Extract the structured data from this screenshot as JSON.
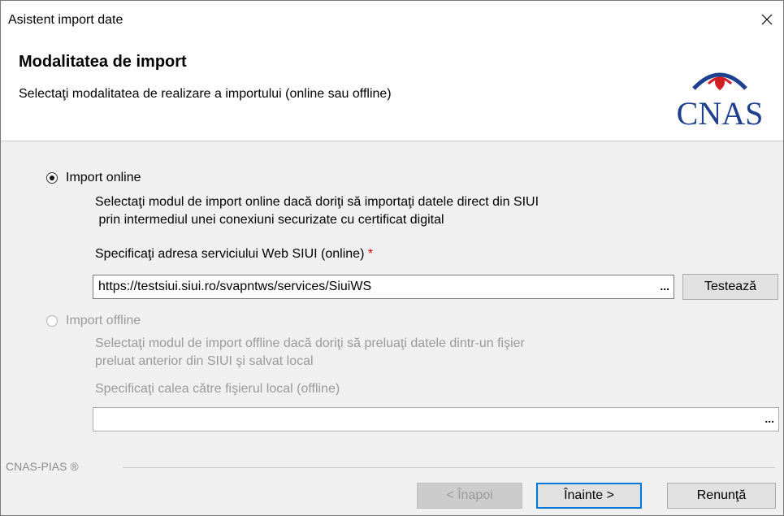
{
  "window": {
    "title": "Asistent import date"
  },
  "header": {
    "heading": "Modalitatea de import",
    "subheading": "Selectaţi modalitatea de realizare a importului (online sau offline)",
    "logo_text": "CNAS"
  },
  "online": {
    "radio_label": "Import online",
    "checked": true,
    "desc_line1": "Selectaţi modul de import online dacă doriţi să importaţi datele direct din SIUI",
    "desc_line2": " prin intermediul unei conexiuni securizate cu certificat digital",
    "address_label": "Specificaţi adresa serviciului Web SIUI (online)",
    "required_mark": "*",
    "address_value": "https://testsiui.siui.ro/svapntws/services/SiuiWS",
    "browse_label": "...",
    "test_button": "Testează"
  },
  "offline": {
    "radio_label": "Import offline",
    "checked": false,
    "desc_line1": "Selectaţi modul de import offline dacă doriţi să preluaţi datele dintr-un fişier",
    "desc_line2": "preluat anterior din SIUI şi salvat local",
    "path_label": "Specificaţi calea către fişierul local (offline)",
    "path_value": "",
    "browse_label": "..."
  },
  "footer": {
    "group_label": "CNAS-PIAS ®",
    "back_button": "< Înapoi",
    "next_button": "Înainte >",
    "cancel_button": "Renunţă"
  },
  "icons": {
    "close": "close-icon",
    "logo": "cnas-logo"
  },
  "colors": {
    "logo_blue": "#1f3f8f",
    "logo_red": "#d21f26",
    "required_red": "#d00000",
    "focus_blue": "#0078d7"
  }
}
